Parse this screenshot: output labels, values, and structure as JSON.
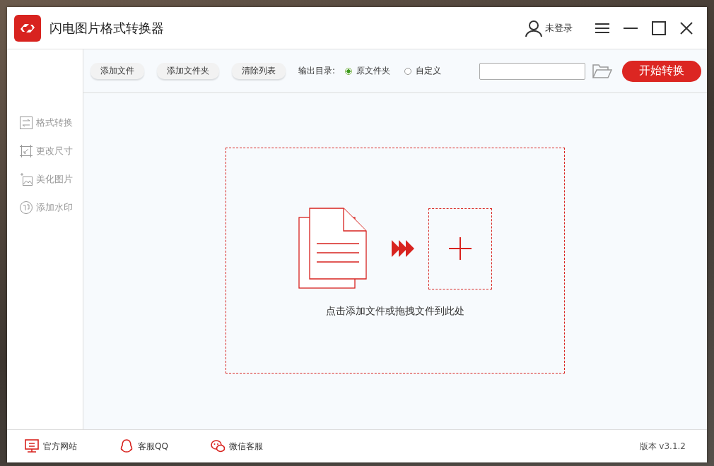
{
  "window": {
    "title": "闪电图片格式转换器",
    "user": "未登录"
  },
  "sidebar": {
    "items": [
      {
        "label": "格式转换",
        "kind": "convert"
      },
      {
        "label": "更改尺寸",
        "kind": "resize"
      },
      {
        "label": "美化图片",
        "kind": "beautify"
      },
      {
        "label": "添加水印",
        "kind": "watermark"
      }
    ]
  },
  "toolbar": {
    "buttons": [
      "添加文件",
      "添加文件夹",
      "清除列表"
    ],
    "output_label": "输出目录:",
    "options": [
      {
        "label": "原文件夹",
        "selected": true
      },
      {
        "label": "自定义",
        "selected": false
      }
    ],
    "start_button": "开始转换"
  },
  "drop_area": {
    "hint": "点击添加文件或拖拽文件到此处"
  },
  "footer": {
    "links": [
      {
        "label": "官方网站",
        "kind": "website"
      },
      {
        "label": "客服QQ",
        "kind": "qq"
      },
      {
        "label": "微信客服",
        "kind": "wechat"
      }
    ],
    "version": "版本 v3.1.2"
  }
}
